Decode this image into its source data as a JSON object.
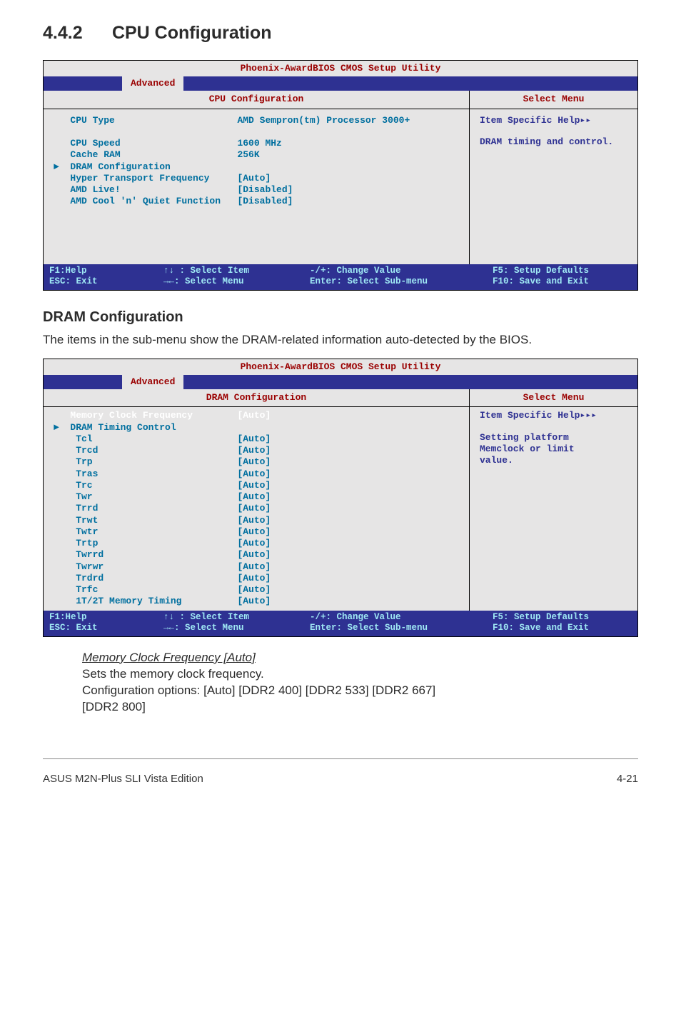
{
  "sectionNumber": "4.4.2",
  "sectionTitle": "CPU Configuration",
  "bios1": {
    "utilityTitle": "Phoenix-AwardBIOS CMOS Setup Utility",
    "activeTab": "Advanced",
    "leftHeader": "CPU Configuration",
    "rightHeader": "Select Menu",
    "helpLine1": "Item Specific Help▸▸",
    "helpBody": "DRAM timing and control.",
    "rows": [
      [
        "CPU Type",
        "AMD Sempron(tm) Processor 3000+"
      ],
      [
        "",
        ""
      ],
      [
        "CPU Speed",
        "1600 MHz"
      ],
      [
        "Cache RAM",
        "256K"
      ],
      [
        "DRAM Configuration",
        ""
      ],
      [
        "Hyper Transport Frequency",
        "[Auto]"
      ],
      [
        "AMD Live!",
        "[Disabled]"
      ],
      [
        "AMD Cool 'n' Quiet Function",
        "[Disabled]"
      ]
    ],
    "markerRowIndex": 4,
    "marker": "►",
    "footer": {
      "l1c1": "F1:Help",
      "l1c2": "↑↓ : Select Item",
      "l1c3": "-/+: Change Value",
      "l1c4": "F5: Setup Defaults",
      "l2c1": "ESC: Exit",
      "l2c2": "→←: Select Menu",
      "l2c3": "Enter: Select Sub-menu",
      "l2c4": "F10: Save and Exit"
    }
  },
  "subHeading": "DRAM Configuration",
  "subDesc": "The items in the sub-menu show the DRAM-related information auto-detected by the BIOS.",
  "bios2": {
    "utilityTitle": "Phoenix-AwardBIOS CMOS Setup Utility",
    "activeTab": "Advanced",
    "leftHeader": "DRAM Configuration",
    "rightHeader": "Select Menu",
    "helpLine1": "Item Specific Help▸▸▸",
    "helpBodyL1": "Setting platform",
    "helpBodyL2": "Memclock or limit",
    "helpBodyL3": "value.",
    "rows": [
      [
        "Memory Clock Frequency",
        "[Auto]"
      ],
      [
        "DRAM Timing Control",
        ""
      ],
      [
        " Tcl",
        "[Auto]"
      ],
      [
        " Trcd",
        "[Auto]"
      ],
      [
        " Trp",
        "[Auto]"
      ],
      [
        " Tras",
        "[Auto]"
      ],
      [
        " Trc",
        "[Auto]"
      ],
      [
        " Twr",
        "[Auto]"
      ],
      [
        " Trrd",
        "[Auto]"
      ],
      [
        " Trwt",
        "[Auto]"
      ],
      [
        " Twtr",
        "[Auto]"
      ],
      [
        " Trtp",
        "[Auto]"
      ],
      [
        " Twrrd",
        "[Auto]"
      ],
      [
        " Twrwr",
        "[Auto]"
      ],
      [
        " Trdrd",
        "[Auto]"
      ],
      [
        " Trfc",
        "[Auto]"
      ],
      [
        " 1T/2T Memory Timing",
        "[Auto]"
      ]
    ],
    "highlightRowIndex": 0,
    "markerRowIndex": 1,
    "marker": "►",
    "footer": {
      "l1c1": "F1:Help",
      "l1c2": "↑↓ : Select Item",
      "l1c3": "-/+: Change Value",
      "l1c4": "F5: Setup Defaults",
      "l2c1": "ESC: Exit",
      "l2c2": "→←: Select Menu",
      "l2c3": "Enter: Select Sub-menu",
      "l2c4": "F10: Save and Exit"
    }
  },
  "detail": {
    "label": "Memory Clock Frequency [Auto]",
    "line1": "Sets the memory clock frequency.",
    "line2": "Configuration options: [Auto] [DDR2 400] [DDR2 533] [DDR2 667]",
    "line3": "[DDR2 800]"
  },
  "pageFooter": {
    "left": "ASUS M2N-Plus SLI Vista Edition",
    "right": "4-21"
  }
}
